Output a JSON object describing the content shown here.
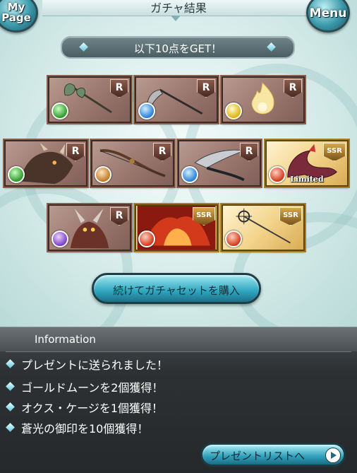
{
  "header": {
    "title": "ガチャ結果",
    "mypage_label_line1": "My",
    "mypage_label_line2": "Page",
    "menu_label": "Menu"
  },
  "result_banner": "以下10点をGET！",
  "items": [
    {
      "rarity": "R",
      "element": "wind",
      "depicts": "axe"
    },
    {
      "rarity": "R",
      "element": "water",
      "depicts": "scythe"
    },
    {
      "rarity": "R",
      "element": "light",
      "depicts": "flame-spirit"
    },
    {
      "rarity": "R",
      "element": "wind",
      "depicts": "beast"
    },
    {
      "rarity": "R",
      "element": "earth",
      "depicts": "bow"
    },
    {
      "rarity": "R",
      "element": "water",
      "depicts": "curved-blade"
    },
    {
      "rarity": "SSR",
      "element": "fire",
      "depicts": "dragon",
      "badge": "Limited"
    },
    {
      "rarity": "R",
      "element": "dark",
      "depicts": "demon"
    },
    {
      "rarity": "SSR",
      "element": "fire",
      "depicts": "fire-beast"
    },
    {
      "rarity": "SSR",
      "element": "fire",
      "depicts": "staff"
    }
  ],
  "buy_button": "続けてガチャセットを購入",
  "information": {
    "title": "Information",
    "messages": [
      "プレゼントに送られました！",
      "ゴールドムーンを2個獲得！",
      "オクス・ケージを1個獲得！",
      "蒼光の御印を10個獲得！"
    ],
    "present_list_button": "プレゼントリストへ"
  }
}
